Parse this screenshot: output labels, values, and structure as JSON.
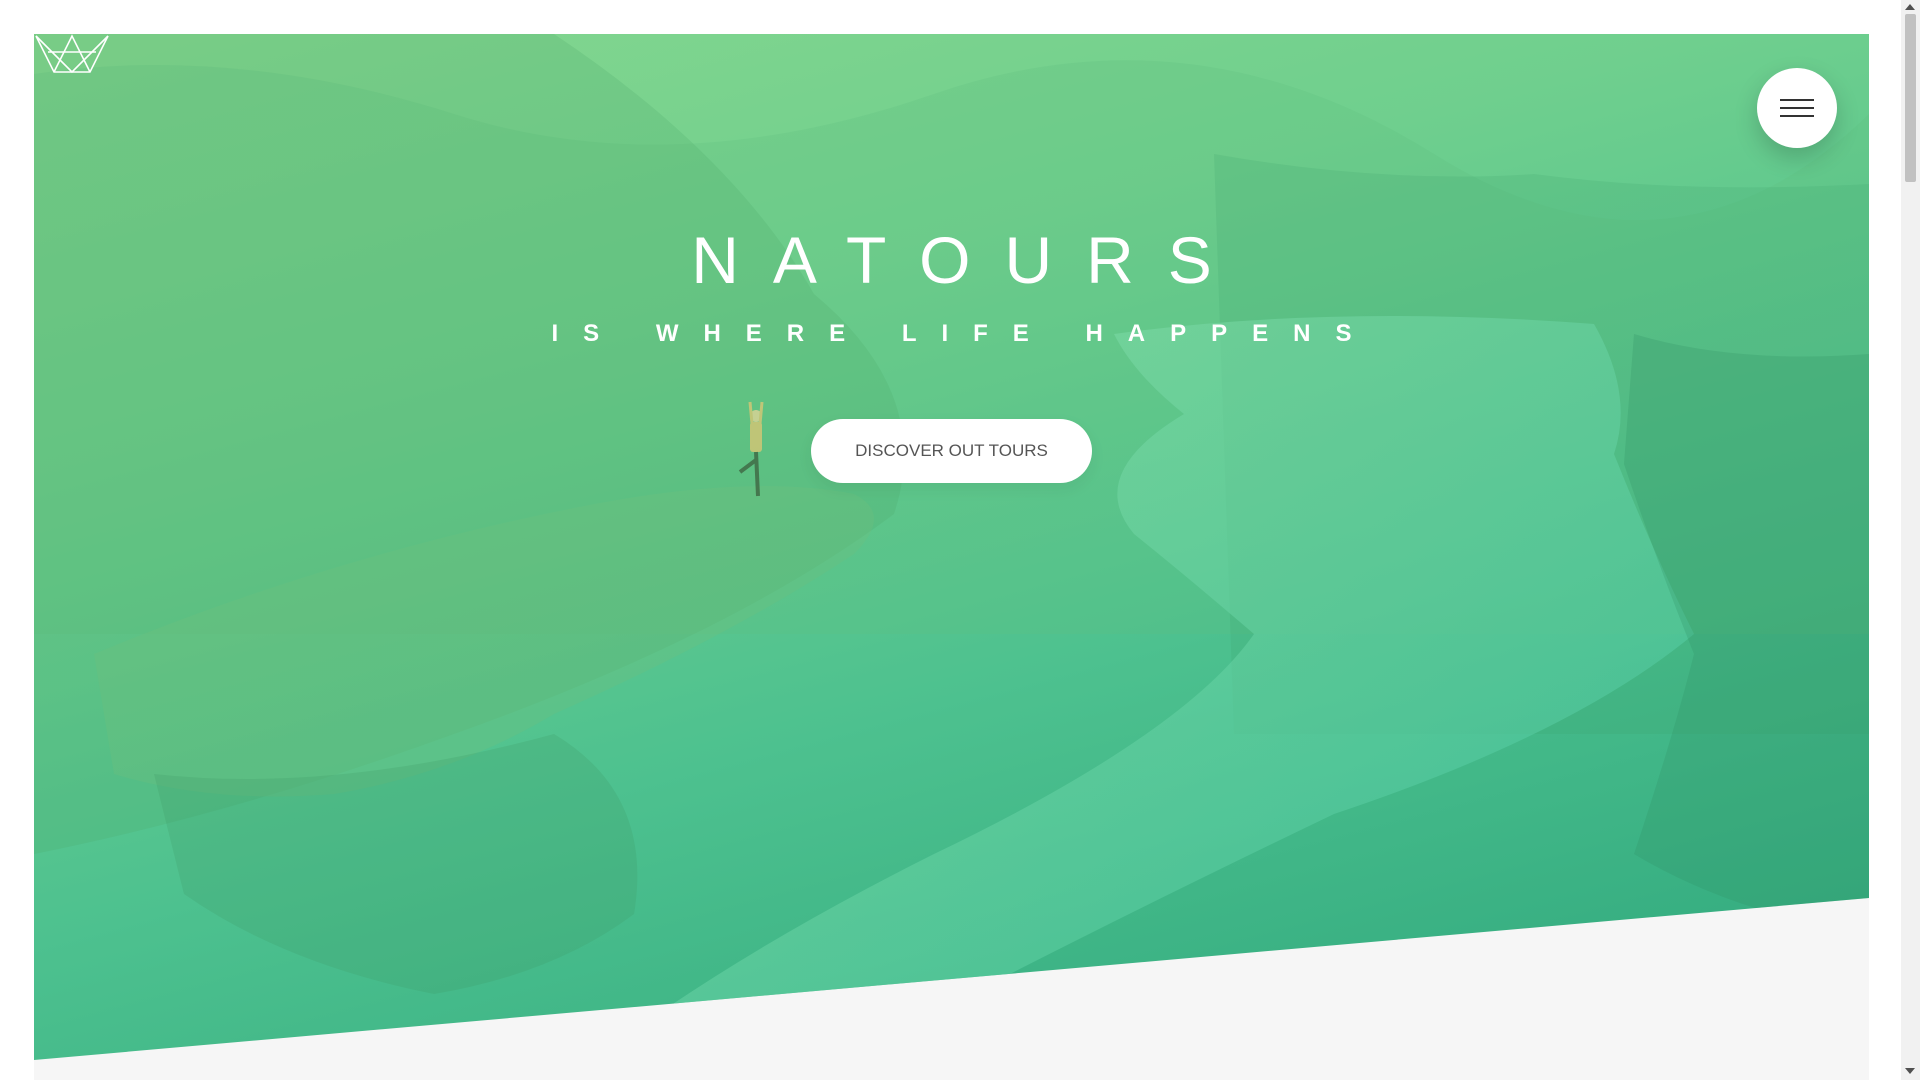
{
  "page": {
    "logo_icon": "crown-logo-icon",
    "menu_icon": "hamburger-menu-icon"
  },
  "hero": {
    "title": "NATOURS",
    "subtitle": "IS WHERE LIFE HAPPENS",
    "cta_label": "DISCOVER OUT TOURS"
  },
  "colors": {
    "gradient_light": "#86d78f",
    "gradient_dark": "#2ea77c",
    "page_background": "#f6f6f6",
    "button_background": "#ffffff",
    "button_text": "#555555"
  }
}
